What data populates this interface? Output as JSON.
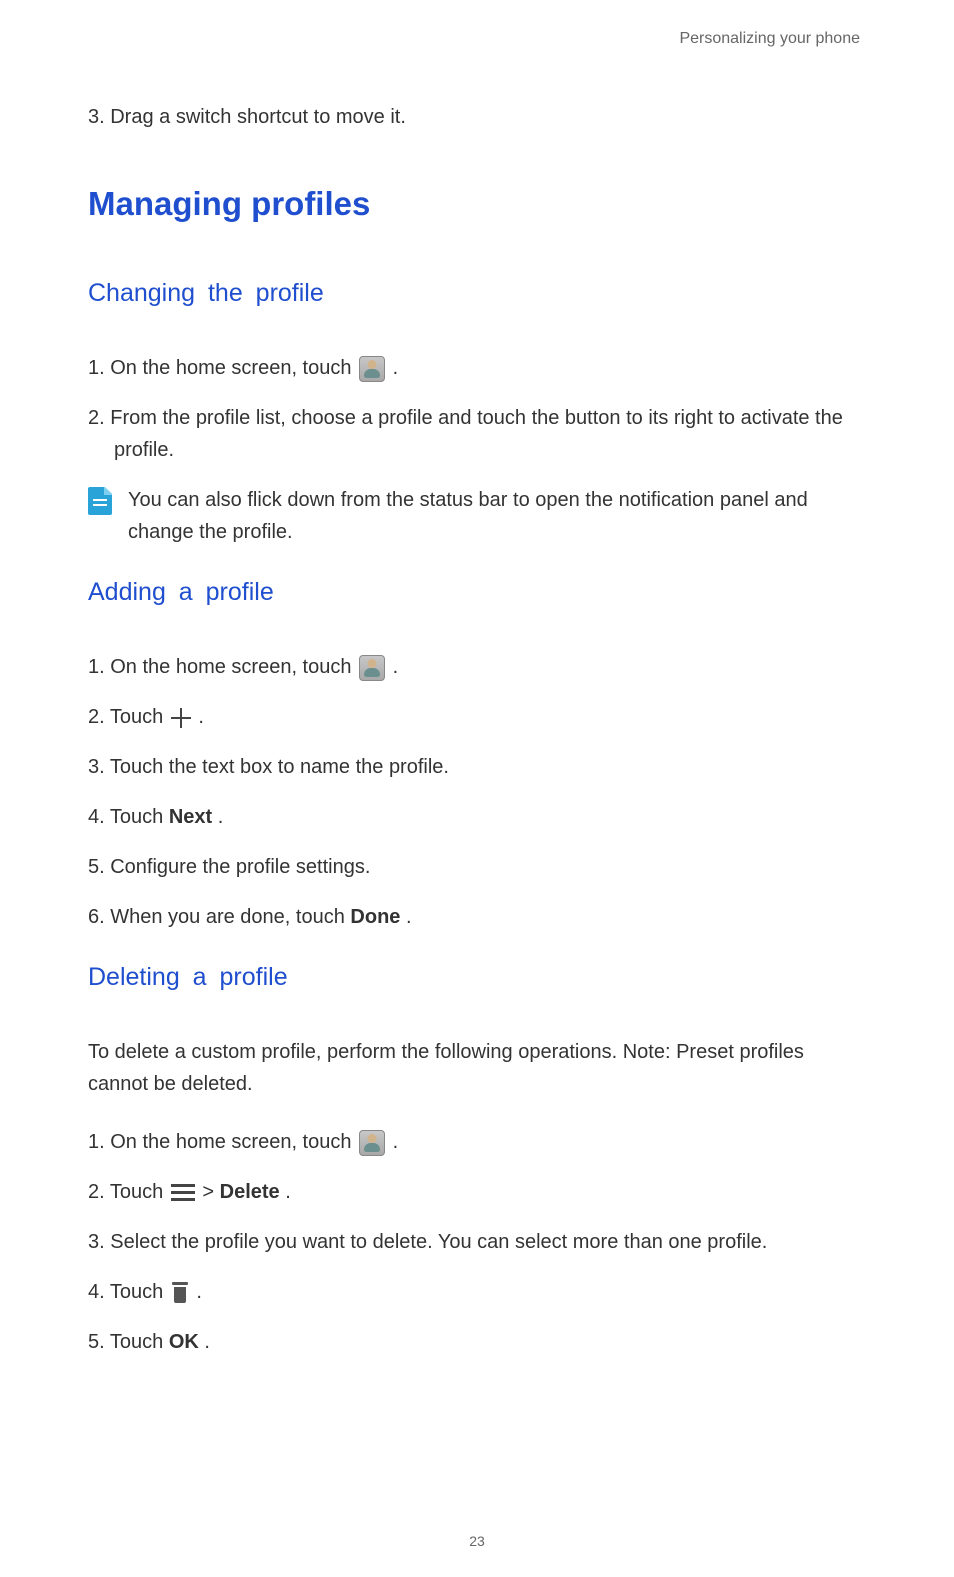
{
  "header": {
    "chapter": "Personalizing your phone"
  },
  "intro_step": "3. Drag a switch shortcut to move it.",
  "section_title": "Managing profiles",
  "changing": {
    "title": "Changing  the  profile",
    "steps": {
      "s1_pre": "1. On the home screen, touch ",
      "s1_post": " .",
      "s2": "2. From the profile list, choose a profile and touch the button to its right to activate the profile."
    },
    "note": "You can also flick down from the status bar to open the notification panel and change the profile."
  },
  "adding": {
    "title": "Adding  a  profile",
    "steps": {
      "s1_pre": "1. On the home screen, touch ",
      "s1_post": " .",
      "s2_pre": "2. Touch ",
      "s2_post": " .",
      "s3": "3. Touch the text box to name the profile.",
      "s4_pre": "4. Touch ",
      "s4_bold": "Next",
      "s4_post": ".",
      "s5": "5. Configure the profile settings.",
      "s6_pre": "6. When you are done, touch ",
      "s6_bold": "Done",
      "s6_post": "."
    }
  },
  "deleting": {
    "title": "Deleting  a  profile",
    "intro": "To delete a custom profile, perform the following operations. Note: Preset profiles cannot be deleted.",
    "steps": {
      "s1_pre": "1. On the home screen, touch ",
      "s1_post": " .",
      "s2_pre": "2. Touch ",
      "s2_mid": "  > ",
      "s2_bold": "Delete",
      "s2_post": ".",
      "s3": "3. Select the profile you want to delete. You can select more than one profile.",
      "s4_pre": "4. Touch ",
      "s4_post": " .",
      "s5_pre": "5. Touch ",
      "s5_bold": "OK",
      "s5_post": "."
    }
  },
  "page_number": "23"
}
